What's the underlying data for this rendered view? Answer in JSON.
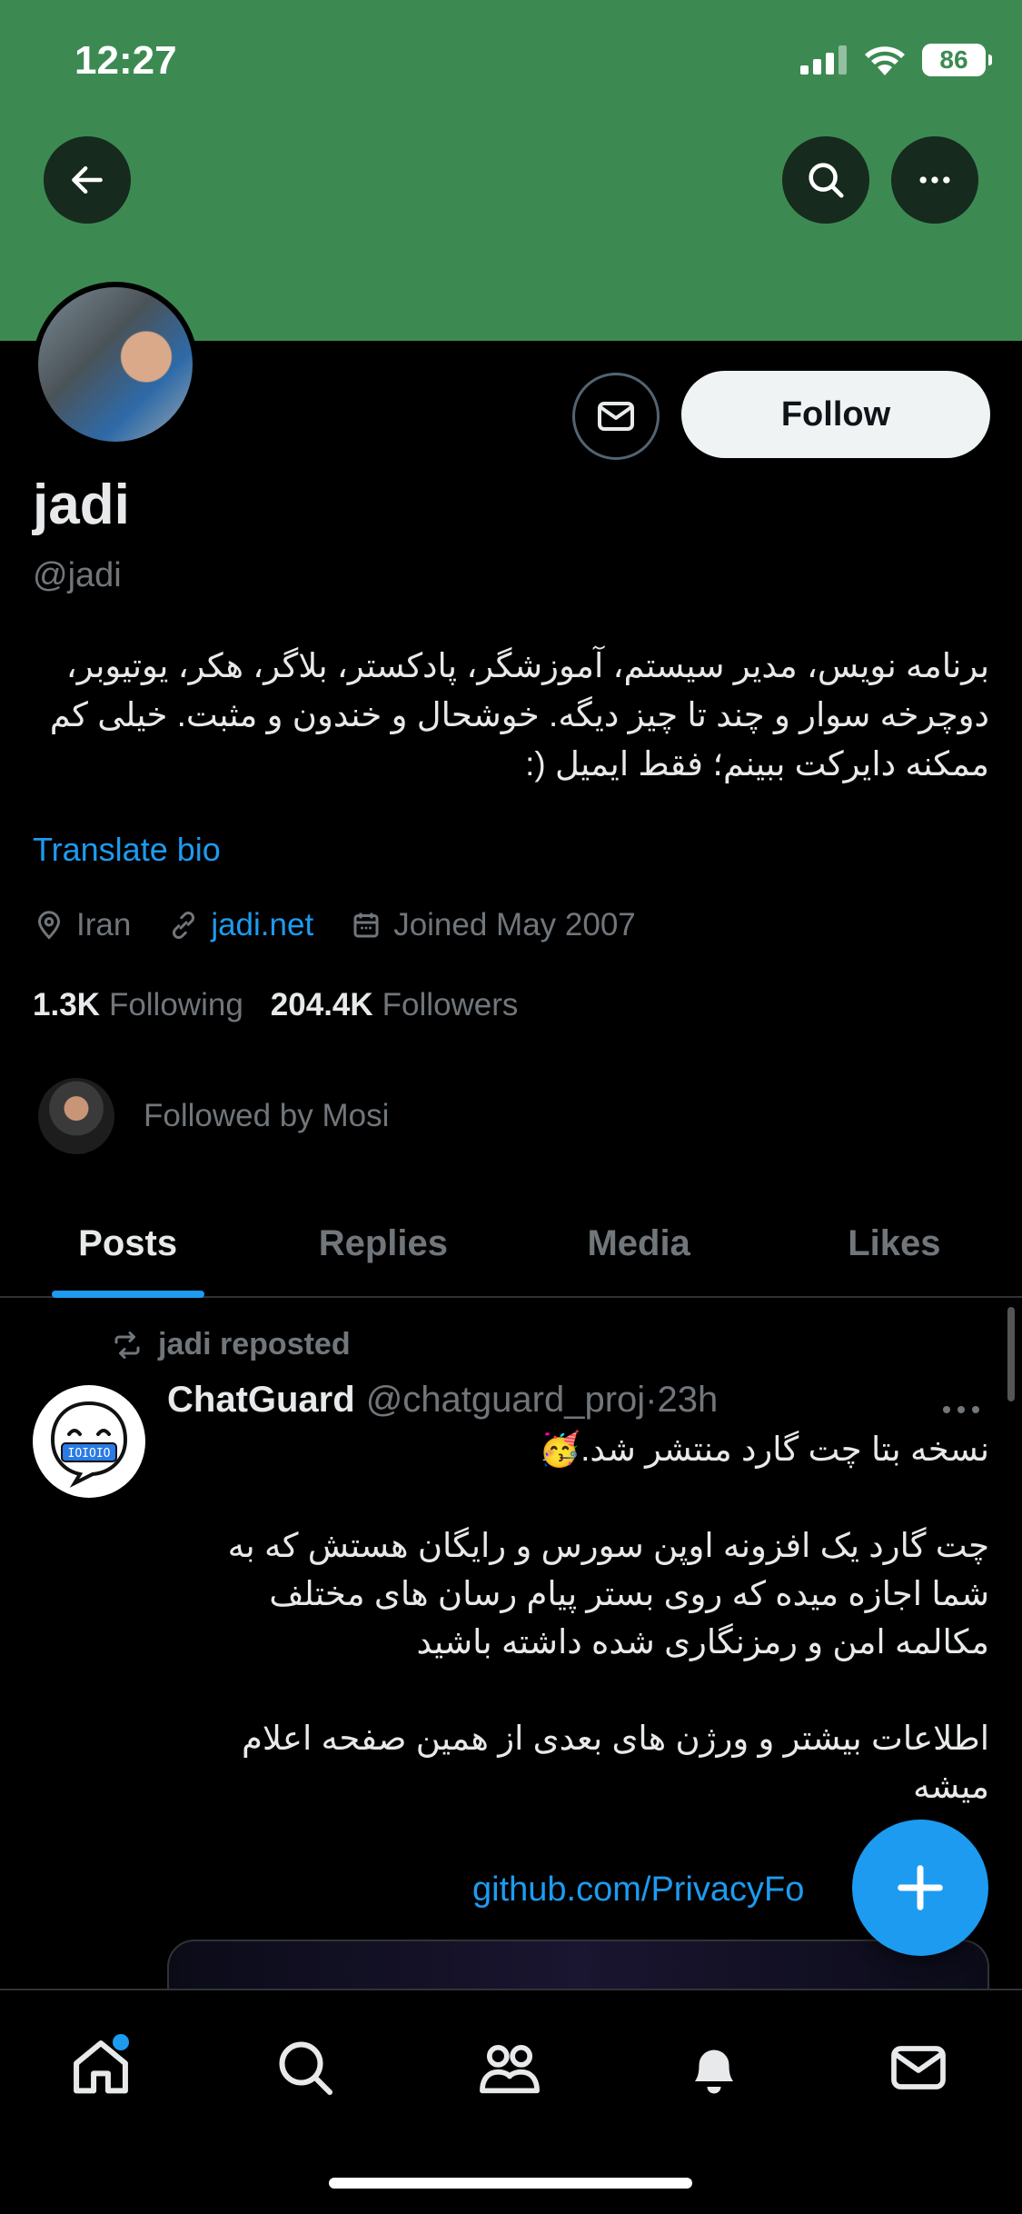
{
  "status_bar": {
    "time": "12:27",
    "battery": "86"
  },
  "profile": {
    "name": "jadi",
    "handle": "@jadi",
    "bio": "برنامه نویس، مدیر سیستم، آموزشگر، پادکستر، بلاگر، هکر، یوتیوبر، دوچرخه سوار و چند تا چیز دیگه. خوشحال و خندون و مثبت. خیلی کم ممکنه دایرکت ببینم؛ فقط ایمیل (:",
    "translate_label": "Translate bio",
    "follow_label": "Follow",
    "location": "Iran",
    "website": "jadi.net",
    "joined": "Joined May 2007",
    "following_count": "1.3K",
    "following_label": "Following",
    "followers_count": "204.4K",
    "followers_label": "Followers",
    "followed_by": "Followed by Mosi"
  },
  "tabs": [
    {
      "label": "Posts",
      "active": true
    },
    {
      "label": "Replies",
      "active": false
    },
    {
      "label": "Media",
      "active": false
    },
    {
      "label": "Likes",
      "active": false
    }
  ],
  "post": {
    "repost_label": "jadi reposted",
    "author_name": "ChatGuard",
    "author_handle": "@chatguard_proj",
    "time": "·23h",
    "para1": "نسخه بتا چت گارد منتشر شد.🥳",
    "para2": "چت گارد یک افزونه اوپن سورس و رایگان هستش که به شما اجازه میده که روی بستر پیام رسان های مختلف مکالمه امن و رمزنگاری شده داشته باشید",
    "para3": "اطلاعات بیشتر و ورژن های بعدی از همین صفحه اعلام میشه",
    "link": "github.com/PrivacyFo"
  },
  "icons": {
    "back": "arrow-left-icon",
    "search": "search-icon",
    "more": "more-horizontal-icon",
    "message": "mail-icon",
    "compose": "plus-icon"
  },
  "colors": {
    "banner": "#3c8a52",
    "accent": "#1d9bf0"
  }
}
